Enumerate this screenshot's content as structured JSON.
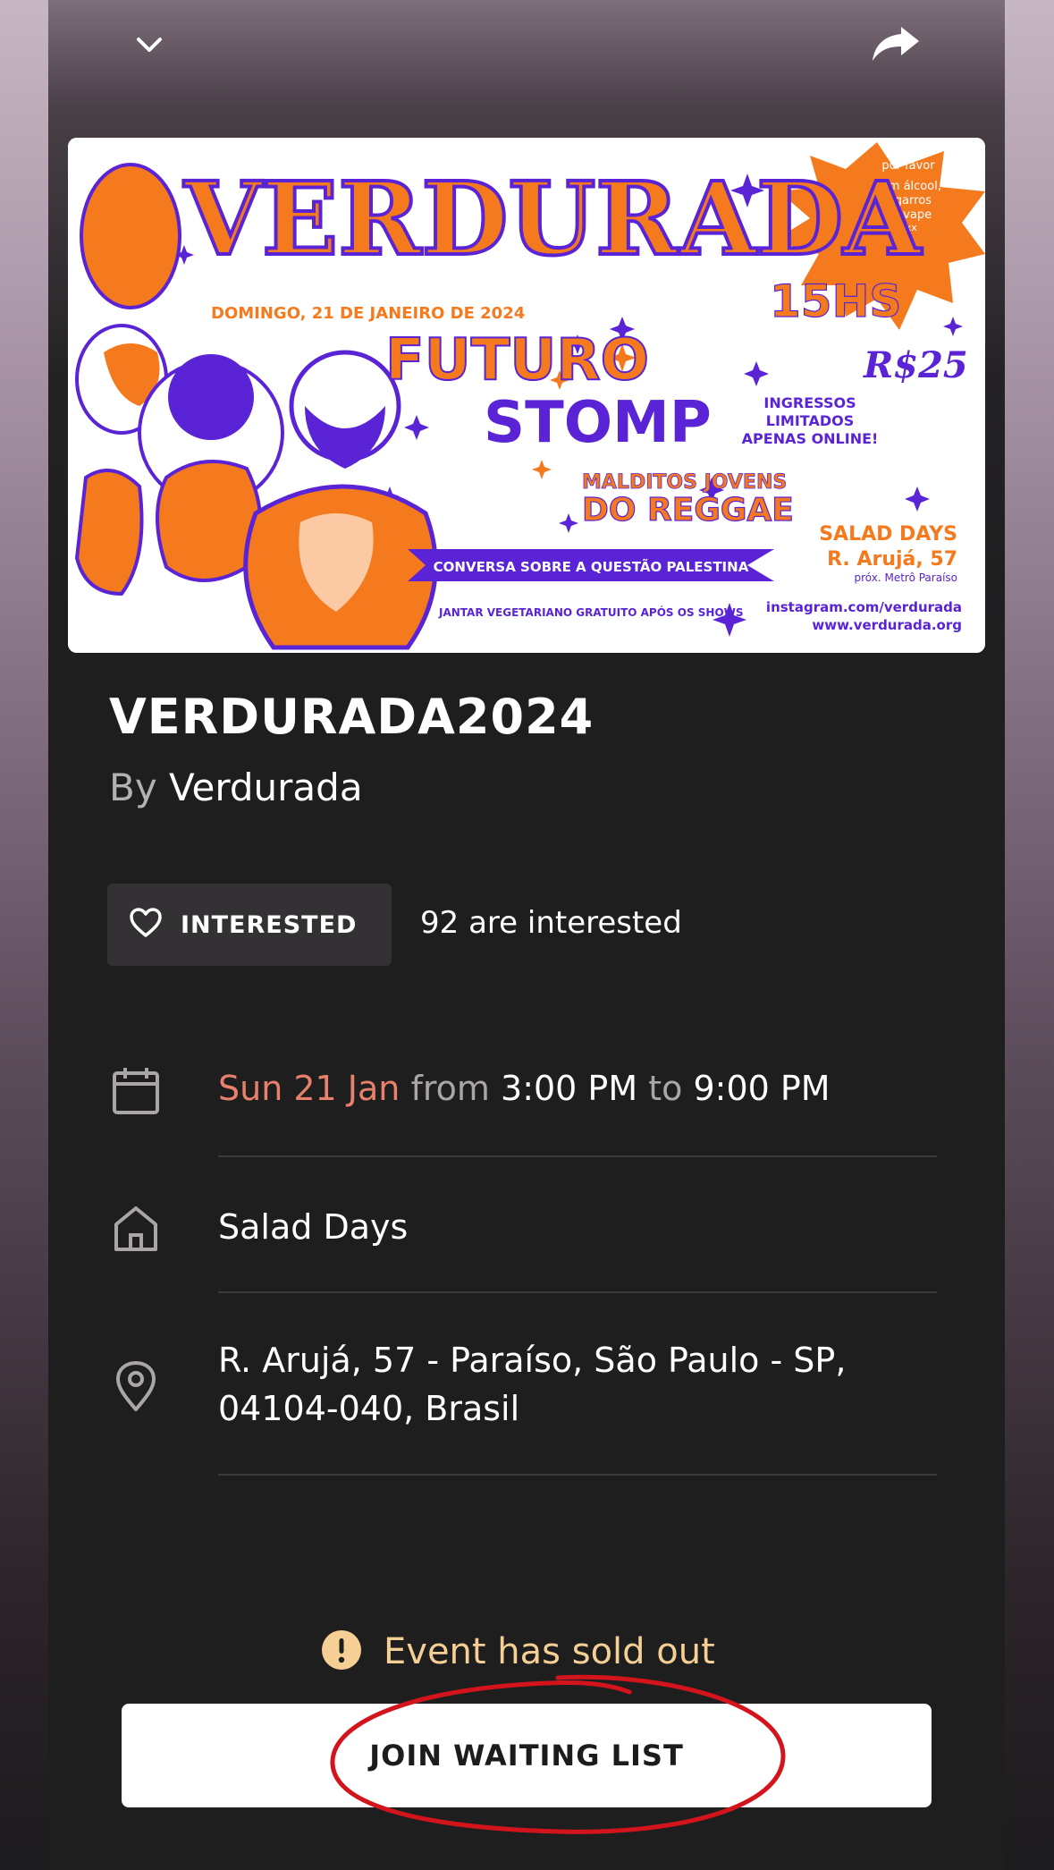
{
  "colors": {
    "accent_date": "#e8816c",
    "soldout_text": "#f6cf95",
    "poster_orange": "#f47a1d",
    "poster_purple": "#5a24d6",
    "annotation_red": "#d4141c"
  },
  "topbar": {
    "collapse_icon": "chevron-down-icon",
    "share_icon": "share-arrow-icon"
  },
  "poster": {
    "headline": "VERDURADA",
    "date_line": "DOMINGO, 21 DE JANEIRO DE 2024",
    "band1": "FUTURO",
    "band2": "STOMP",
    "band3_line1": "MALDITOS JOVENS",
    "band3_line2": "DO REGGAE",
    "time": "15HS",
    "price": "R$25",
    "tickets": [
      "INGRESSOS",
      "LIMITADOS",
      "APENAS ONLINE!"
    ],
    "burst": [
      "por favor",
      "sem álcool,",
      "cigarros",
      "ou vape",
      "xxx"
    ],
    "venue": "SALAD DAYS",
    "venue_address": "R. Arujá, 57",
    "venue_near": "próx. Metrô Paraíso",
    "talk": "CONVERSA SOBRE A QUESTÃO PALESTINA",
    "dinner": "JANTAR VEGETARIANO GRATUITO APÓS OS SHOWS",
    "instagram": "instagram.com/verdurada",
    "website": "www.verdurada.org"
  },
  "event": {
    "title": "VERDURADA2024",
    "by_label": "By",
    "organizer": "Verdurada"
  },
  "interest": {
    "button_label": "INTERESTED",
    "count": "92",
    "count_suffix": "are interested"
  },
  "details": {
    "date": "Sun 21 Jan",
    "from_word": "from",
    "start": "3:00 PM",
    "to_word": "to",
    "end": "9:00 PM",
    "venue": "Salad Days",
    "address_line1": "R. Arujá, 57 - Paraíso, São Paulo - SP,",
    "address_line2": "04104-040, Brasil"
  },
  "status": {
    "soldout_text": "Event has sold out",
    "waiting_button": "JOIN WAITING LIST"
  }
}
